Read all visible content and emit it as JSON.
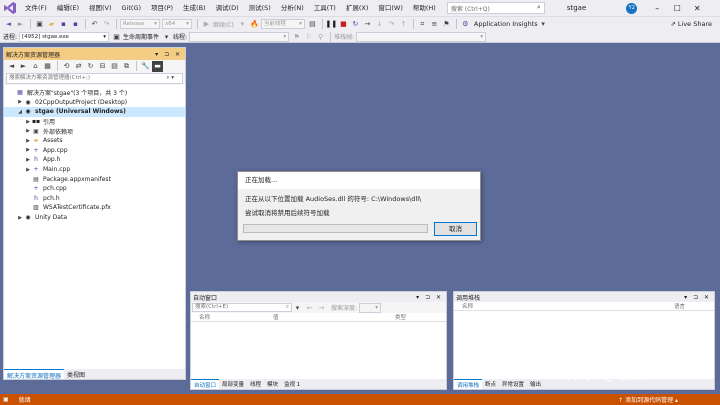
{
  "menubar": {
    "items": [
      "文件(F)",
      "编辑(E)",
      "视图(V)",
      "Git(G)",
      "项目(P)",
      "生成(B)",
      "调试(D)",
      "测试(S)",
      "分析(N)",
      "工具(T)",
      "扩展(X)",
      "窗口(W)",
      "帮助(H)"
    ],
    "search_placeholder": "搜索 (Ctrl+Q)",
    "solution_title": "stgae",
    "avatar_initials": "Y2"
  },
  "toolbar": {
    "config": "Release",
    "platform": "x64",
    "continue_label": "继续(C)",
    "target": "当前线程",
    "app_insights": "Application Insights",
    "live_share": "Live Share",
    "process_label": "进程:",
    "process_value": "[4952] stgae.exe",
    "lifecycle_label": "生命周期事件",
    "thread_label": "线程:",
    "stackframe_label": "堆栈帧:"
  },
  "solution_explorer": {
    "title": "解决方案资源管理器",
    "search_placeholder": "搜索解决方案资源管理器(Ctrl+;)",
    "tree": [
      {
        "label": "解决方案\"stgae\"(3 个项目，共 3 个)",
        "indent": 0,
        "arrow": "",
        "icon": "solution-icon",
        "bold": false,
        "selected": false
      },
      {
        "label": "02CppOutputProject (Desktop)",
        "indent": 1,
        "arrow": "▶",
        "icon": "project-icon",
        "bold": false,
        "selected": false
      },
      {
        "label": "stgae (Universal Windows)",
        "indent": 1,
        "arrow": "◢",
        "icon": "project-icon",
        "bold": true,
        "selected": true
      },
      {
        "label": "引用",
        "indent": 2,
        "arrow": "▶",
        "icon": "references-icon",
        "bold": false,
        "selected": false
      },
      {
        "label": "外部依赖项",
        "indent": 2,
        "arrow": "▶",
        "icon": "external-deps-icon",
        "bold": false,
        "selected": false
      },
      {
        "label": "Assets",
        "indent": 2,
        "arrow": "▶",
        "icon": "folder-icon",
        "bold": false,
        "selected": false
      },
      {
        "label": "App.cpp",
        "indent": 2,
        "arrow": "▶",
        "icon": "cpp-file-icon",
        "bold": false,
        "selected": false
      },
      {
        "label": "App.h",
        "indent": 2,
        "arrow": "▶",
        "icon": "header-file-icon",
        "bold": false,
        "selected": false
      },
      {
        "label": "Main.cpp",
        "indent": 2,
        "arrow": "▶",
        "icon": "cpp-file-icon",
        "bold": false,
        "selected": false
      },
      {
        "label": "Package.appxmanifest",
        "indent": 2,
        "arrow": "",
        "icon": "manifest-icon",
        "bold": false,
        "selected": false
      },
      {
        "label": "pch.cpp",
        "indent": 2,
        "arrow": "",
        "icon": "cpp-file-icon",
        "bold": false,
        "selected": false
      },
      {
        "label": "pch.h",
        "indent": 2,
        "arrow": "",
        "icon": "header-file-icon",
        "bold": false,
        "selected": false
      },
      {
        "label": "WSATestCertificate.pfx",
        "indent": 2,
        "arrow": "",
        "icon": "certificate-icon",
        "bold": false,
        "selected": false
      },
      {
        "label": "Unity Data",
        "indent": 1,
        "arrow": "▶",
        "icon": "project-icon",
        "bold": false,
        "selected": false
      }
    ],
    "tabs": [
      "解决方案资源管理器",
      "类视图"
    ]
  },
  "dialog": {
    "title": "正在加载...",
    "message": "正在从以下位置加载 AudioSes.dll 的符号: C:\\Windows\\dll\\",
    "hint": "尝试取消将禁用后续符号加载",
    "progress": 0,
    "cancel_label": "取消"
  },
  "autos": {
    "title": "自动窗口",
    "search_placeholder": "搜索(Ctrl+E)",
    "search_depth_label": "搜索深度:",
    "columns": [
      "名称",
      "值",
      "类型"
    ],
    "tabs": [
      "自动窗口",
      "局部变量",
      "线程",
      "模块",
      "监视 1"
    ]
  },
  "callstack": {
    "title": "调用堆栈",
    "columns": [
      "名称",
      "语言"
    ],
    "tabs": [
      "调用堆栈",
      "断点",
      "异常设置",
      "输出"
    ]
  },
  "statusbar": {
    "ready": "就绪",
    "source_control": "添加到源代码管理"
  },
  "watermark": "知乎 @锼殿下"
}
